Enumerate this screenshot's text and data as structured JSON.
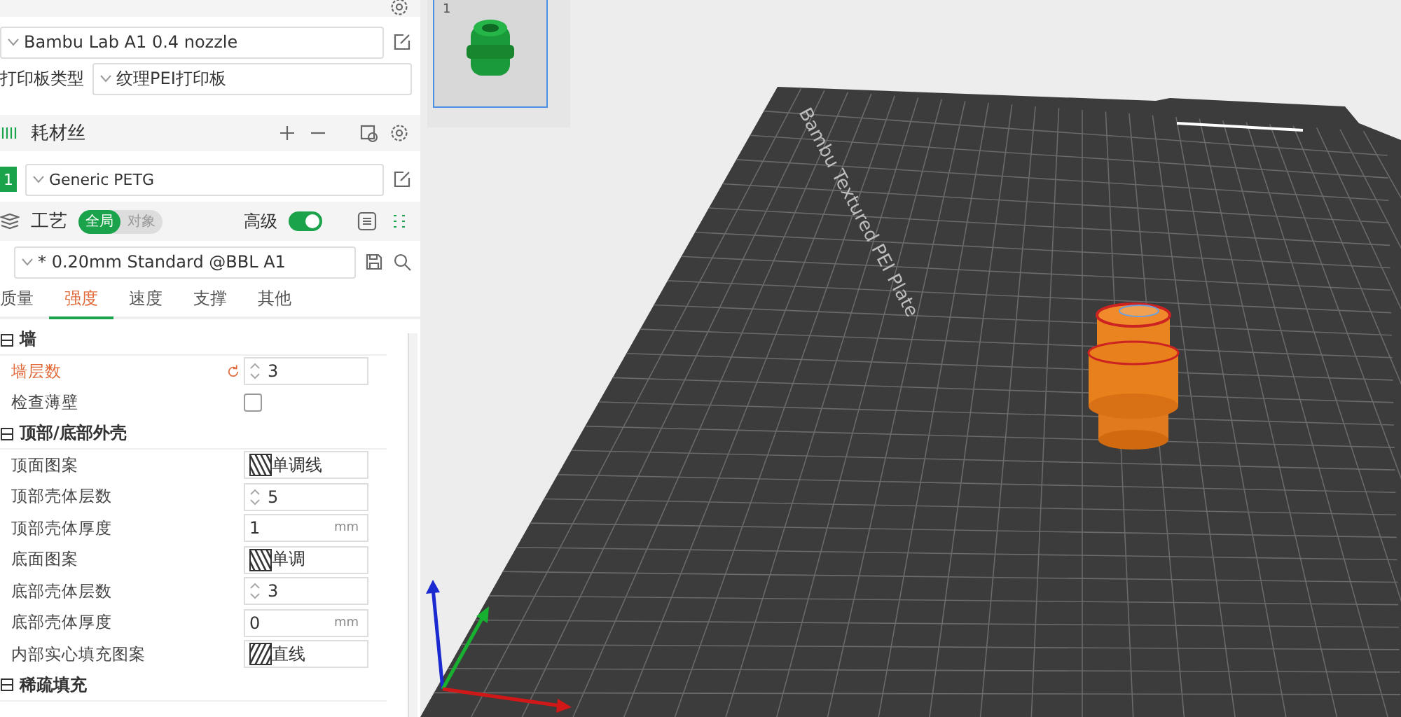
{
  "printer": {
    "preset": "Bambu Lab A1 0.4 nozzle",
    "plate_label": "打印板类型",
    "plate_type": "纹理PEI打印板"
  },
  "filament": {
    "title": "耗材丝",
    "slots": [
      {
        "index": "1",
        "name": "Generic PETG",
        "color": "#1aa34a"
      }
    ]
  },
  "process": {
    "title": "工艺",
    "scope": [
      {
        "label": "全局",
        "selected": true
      },
      {
        "label": "对象",
        "selected": false
      }
    ],
    "advanced_label": "高级",
    "advanced": true,
    "profile": "* 0.20mm Standard @BBL A1"
  },
  "tabs": [
    {
      "label": "质量",
      "selected": false
    },
    {
      "label": "强度",
      "selected": true
    },
    {
      "label": "速度",
      "selected": false
    },
    {
      "label": "支撑",
      "selected": false
    },
    {
      "label": "其他",
      "selected": false
    }
  ],
  "sections": [
    {
      "title": "墙",
      "settings": [
        {
          "kind": "spin",
          "label": "墙层数",
          "value": "3",
          "modified": true
        },
        {
          "kind": "check",
          "label": "检查薄壁",
          "checked": false
        }
      ]
    },
    {
      "title": "顶部/底部外壳",
      "settings": [
        {
          "kind": "pattern",
          "label": "顶面图案",
          "value": "单调线",
          "modified": false
        },
        {
          "kind": "spin",
          "label": "顶部壳体层数",
          "value": "5",
          "modified": false
        },
        {
          "kind": "unit",
          "label": "顶部壳体厚度",
          "value": "1",
          "unit": "mm",
          "modified": false
        },
        {
          "kind": "pattern",
          "label": "底面图案",
          "value": "单调",
          "modified": false
        },
        {
          "kind": "spin",
          "label": "底部壳体层数",
          "value": "3",
          "modified": false
        },
        {
          "kind": "unit",
          "label": "底部壳体厚度",
          "value": "0",
          "unit": "mm",
          "modified": false
        },
        {
          "kind": "cross",
          "label": "内部实心填充图案",
          "value": "直线",
          "modified": false
        }
      ]
    },
    {
      "title": "稀疏填充"
    }
  ],
  "plates": [
    {
      "number": "1",
      "selected": true
    }
  ],
  "bed": {
    "label": "Bambu Textured PEI Plate"
  }
}
